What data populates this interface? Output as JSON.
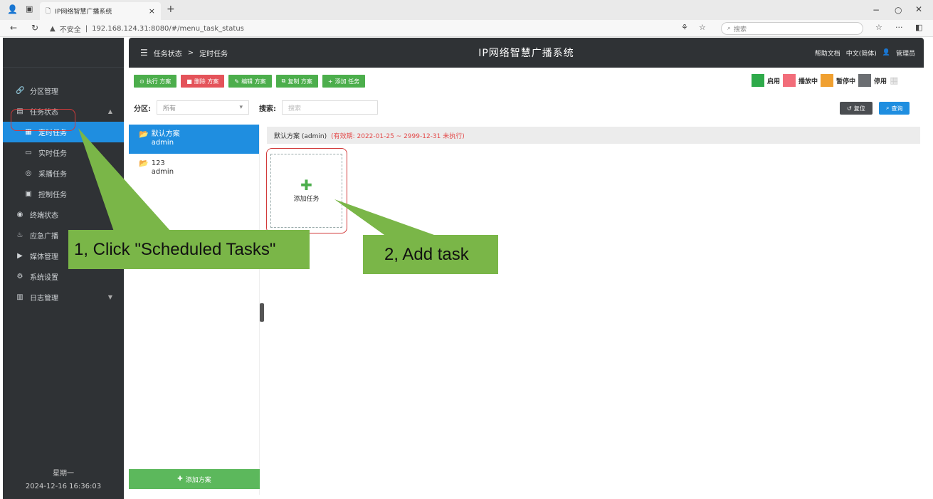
{
  "browser": {
    "tab_title": "IP网络智慧广播系统",
    "security": "不安全",
    "url": "192.168.124.31:8080/#/menu_task_status",
    "search_placeholder": "搜索"
  },
  "header": {
    "breadcrumb_1": "任务状态",
    "breadcrumb_sep": ">",
    "breadcrumb_2": "定时任务",
    "app_title": "IP网络智慧广播系统",
    "help": "帮助文档",
    "language": "中文(简体)",
    "user": "管理员"
  },
  "sidebar": {
    "items": [
      {
        "label": "分区管理",
        "icon": "link-icon"
      },
      {
        "label": "任务状态",
        "icon": "list-icon"
      },
      {
        "label": "定时任务",
        "icon": "calendar-icon"
      },
      {
        "label": "实时任务",
        "icon": "monitor-icon"
      },
      {
        "label": "采播任务",
        "icon": "circle-icon"
      },
      {
        "label": "控制任务",
        "icon": "control-icon"
      },
      {
        "label": "终端状态",
        "icon": "terminal-icon"
      },
      {
        "label": "应急广播",
        "icon": "broadcast-icon"
      },
      {
        "label": "媒体管理",
        "icon": "media-icon"
      },
      {
        "label": "系统设置",
        "icon": "settings-icon"
      },
      {
        "label": "日志管理",
        "icon": "log-icon"
      }
    ],
    "weekday": "星期一",
    "datetime": "2024-12-16 16:36:03"
  },
  "toolbar": {
    "execute": "执行 方案",
    "delete": "删除 方案",
    "edit": "编辑 方案",
    "copy": "复制 方案",
    "add_task": "添加 任务"
  },
  "legend": {
    "enabled": "启用",
    "playing": "播放中",
    "paused": "暂停中",
    "disabled": "停用",
    "colors": {
      "enabled": "#2eaa4a",
      "playing": "#f26d7a",
      "paused": "#f0a030",
      "disabled": "#6b6e72"
    }
  },
  "filter": {
    "zone_label": "分区:",
    "zone_value": "所有",
    "search_label": "搜索:",
    "search_placeholder": "搜索",
    "reset": "复位",
    "query": "查询"
  },
  "schemes": [
    {
      "name": "默认方案",
      "owner": "admin"
    },
    {
      "name": "123",
      "owner": "admin"
    }
  ],
  "add_scheme": "添加方案",
  "content": {
    "scheme_title": "默认方案 (admin)",
    "validity": "(有效期: 2022-01-25 ~ 2999-12-31 未执行)",
    "add_task_card": "添加任务"
  },
  "annotations": {
    "step1": "1, Click \"Scheduled Tasks\"",
    "step2": "2, Add task"
  }
}
